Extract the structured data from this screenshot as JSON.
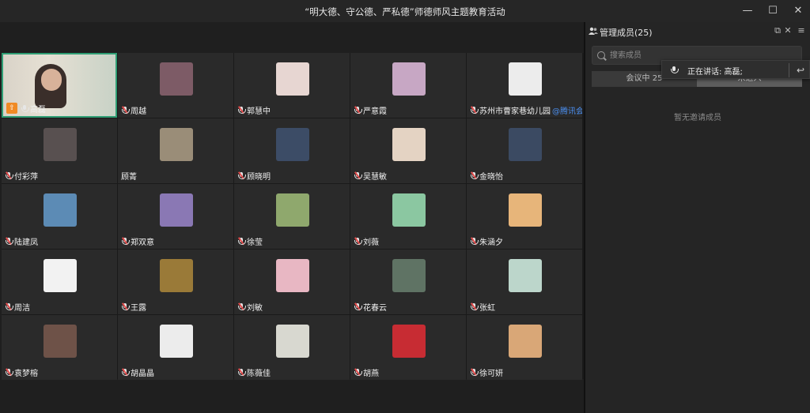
{
  "window": {
    "title": "“明大德、守公德、严私德”师德师风主题教育活动",
    "minimize": "—",
    "maximize": "☐",
    "close": "✕"
  },
  "participants": [
    {
      "name": "高磊",
      "color": "#c9b89c",
      "speaking": true,
      "host": true
    },
    {
      "name": "周越",
      "color": "#7d5b66"
    },
    {
      "name": "郭慧中",
      "color": "#e7d6d2"
    },
    {
      "name": "严意霞",
      "color": "#c7a7c4"
    },
    {
      "name": "苏州市曹家巷幼儿园",
      "tag": "@腾讯会议",
      "color": "#ececec"
    },
    {
      "name": "付彩萍",
      "color": "#585050"
    },
    {
      "name": "顾菁",
      "color": "#9a8d78",
      "nomic": true
    },
    {
      "name": "顾晓明",
      "color": "#3c4c66"
    },
    {
      "name": "吴慧敏",
      "color": "#e4d3c3"
    },
    {
      "name": "金晓怡",
      "color": "#3b4a62"
    },
    {
      "name": "陆建凤",
      "color": "#5c8bb5"
    },
    {
      "name": "郑双意",
      "color": "#8a78b4"
    },
    {
      "name": "徐莹",
      "color": "#8fa86d"
    },
    {
      "name": "刘薇",
      "color": "#8bc7a1"
    },
    {
      "name": "朱涵夕",
      "color": "#e7b57a"
    },
    {
      "name": "周洁",
      "color": "#f2f2f2"
    },
    {
      "name": "王露",
      "color": "#9a7a38"
    },
    {
      "name": "刘敏",
      "color": "#e8b7c3"
    },
    {
      "name": "花春云",
      "color": "#5f7364"
    },
    {
      "name": "张虹",
      "color": "#bcd6cb"
    },
    {
      "name": "袁梦榕",
      "color": "#6e5248"
    },
    {
      "name": "胡晶晶",
      "color": "#ececec"
    },
    {
      "name": "陈薇佳",
      "color": "#d8d8d0"
    },
    {
      "name": "胡燕",
      "color": "#c72c33"
    },
    {
      "name": "徐可妍",
      "color": "#d9a777"
    }
  ],
  "panel": {
    "title": "管理成员(25)",
    "search_placeholder": "搜索成员",
    "tabs": [
      "会议中 25",
      "未进入"
    ],
    "empty_text": "暂无邀请成员",
    "popout_icon": "⧉",
    "close_icon": "✕",
    "menu_icon": "≡"
  },
  "speaking_popup": {
    "text": "正在讲话: 高磊;",
    "back_icon": "↩"
  }
}
